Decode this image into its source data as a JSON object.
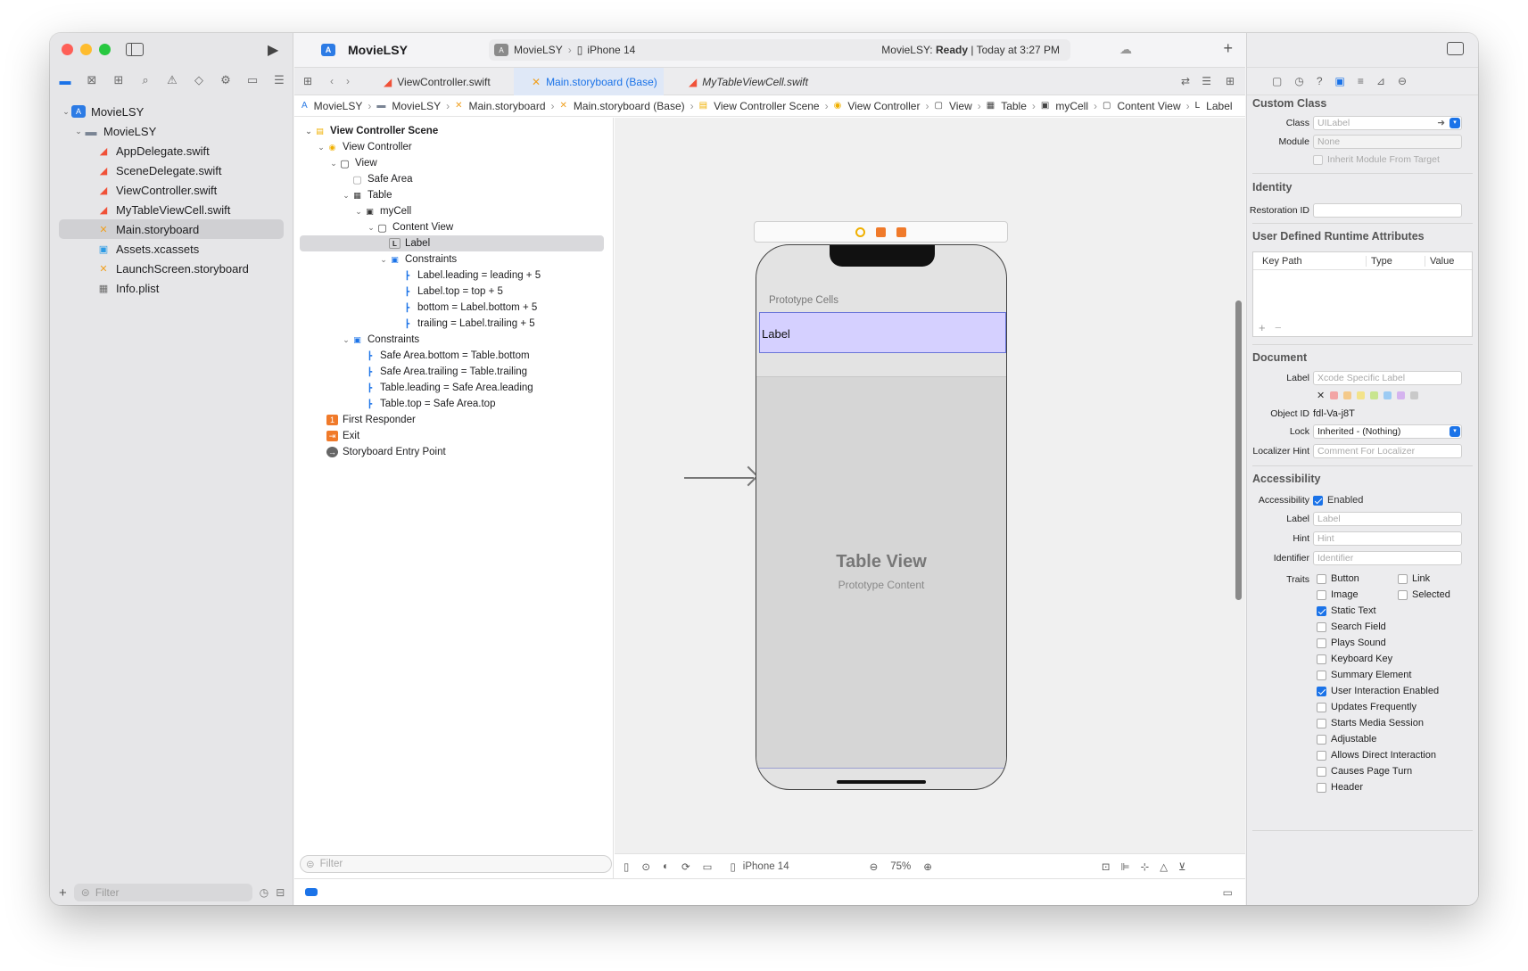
{
  "project": {
    "name": "MovieLSY"
  },
  "scheme": {
    "target": "MovieLSY",
    "device": "iPhone 14",
    "status_prefix": "MovieLSY:",
    "status": "Ready",
    "status_time": "Today at 3:27 PM"
  },
  "navigator": {
    "items": [
      {
        "label": "MovieLSY",
        "kind": "project",
        "level": 0
      },
      {
        "label": "MovieLSY",
        "kind": "folder",
        "level": 1
      },
      {
        "label": "AppDelegate.swift",
        "kind": "swift",
        "level": 2
      },
      {
        "label": "SceneDelegate.swift",
        "kind": "swift",
        "level": 2
      },
      {
        "label": "ViewController.swift",
        "kind": "swift",
        "level": 2
      },
      {
        "label": "MyTableViewCell.swift",
        "kind": "swift",
        "level": 2
      },
      {
        "label": "Main.storyboard",
        "kind": "storyboard",
        "level": 2,
        "selected": true
      },
      {
        "label": "Assets.xcassets",
        "kind": "assets",
        "level": 2
      },
      {
        "label": "LaunchScreen.storyboard",
        "kind": "storyboard",
        "level": 2
      },
      {
        "label": "Info.plist",
        "kind": "plist",
        "level": 2
      }
    ],
    "filter_placeholder": "Filter"
  },
  "tabs": [
    {
      "label": "ViewController.swift"
    },
    {
      "label": "Main.storyboard (Base)",
      "active": true
    },
    {
      "label": "MyTableViewCell.swift"
    }
  ],
  "breadcrumb": [
    "MovieLSY",
    "MovieLSY",
    "Main.storyboard",
    "Main.storyboard (Base)",
    "View Controller Scene",
    "View Controller",
    "View",
    "Table",
    "myCell",
    "Content View",
    "Label"
  ],
  "outline": {
    "items": [
      {
        "label": "View Controller Scene",
        "level": 0,
        "icon": "scene",
        "bold": true
      },
      {
        "label": "View Controller",
        "level": 1,
        "icon": "vc"
      },
      {
        "label": "View",
        "level": 2,
        "icon": "view"
      },
      {
        "label": "Safe Area",
        "level": 3,
        "icon": "safe",
        "leaf": true
      },
      {
        "label": "Table",
        "level": 3,
        "icon": "table"
      },
      {
        "label": "myCell",
        "level": 4,
        "icon": "cell"
      },
      {
        "label": "Content View",
        "level": 5,
        "icon": "view"
      },
      {
        "label": "Label",
        "level": 6,
        "icon": "label",
        "leaf": true,
        "selected": true
      },
      {
        "label": "Constraints",
        "level": 6,
        "icon": "constraints"
      },
      {
        "label": "Label.leading = leading + 5",
        "level": 7,
        "icon": "constraint",
        "leaf": true
      },
      {
        "label": "Label.top = top + 5",
        "level": 7,
        "icon": "constraint",
        "leaf": true
      },
      {
        "label": "bottom = Label.bottom + 5",
        "level": 7,
        "icon": "constraint",
        "leaf": true
      },
      {
        "label": "trailing = Label.trailing + 5",
        "level": 7,
        "icon": "constraint",
        "leaf": true
      },
      {
        "label": "Constraints",
        "level": 3,
        "icon": "constraints"
      },
      {
        "label": "Safe Area.bottom = Table.bottom",
        "level": 4,
        "icon": "constraint",
        "leaf": true
      },
      {
        "label": "Safe Area.trailing = Table.trailing",
        "level": 4,
        "icon": "constraint",
        "leaf": true
      },
      {
        "label": "Table.leading = Safe Area.leading",
        "level": 4,
        "icon": "constraint",
        "leaf": true
      },
      {
        "label": "Table.top = Safe Area.top",
        "level": 4,
        "icon": "constraint",
        "leaf": true
      },
      {
        "label": "First Responder",
        "level": 1,
        "icon": "responder",
        "leaf": true
      },
      {
        "label": "Exit",
        "level": 1,
        "icon": "exit",
        "leaf": true
      },
      {
        "label": "Storyboard Entry Point",
        "level": 1,
        "icon": "entry",
        "leaf": true
      }
    ],
    "filter_placeholder": "Filter"
  },
  "canvas": {
    "prototype_cells": "Prototype Cells",
    "cell_label": "Label",
    "table_title": "Table View",
    "table_subtitle": "Prototype Content",
    "device": "iPhone 14",
    "zoom": "75%"
  },
  "inspector": {
    "custom_class": {
      "title": "Custom Class",
      "class_label": "Class",
      "class_placeholder": "UILabel",
      "module_label": "Module",
      "module_placeholder": "None",
      "inherit_label": "Inherit Module From Target"
    },
    "identity": {
      "title": "Identity",
      "restoration_label": "Restoration ID"
    },
    "runtime": {
      "title": "User Defined Runtime Attributes",
      "col_key": "Key Path",
      "col_type": "Type",
      "col_value": "Value"
    },
    "document": {
      "title": "Document",
      "label_label": "Label",
      "label_placeholder": "Xcode Specific Label",
      "object_id_label": "Object ID",
      "object_id": "fdl-Va-j8T",
      "lock_label": "Lock",
      "lock_value": "Inherited - (Nothing)",
      "localizer_label": "Localizer Hint",
      "localizer_placeholder": "Comment For Localizer",
      "colors": [
        "#f2a5a5",
        "#f4c98a",
        "#f3e38a",
        "#c8e58f",
        "#9ccbf3",
        "#d5b3ef",
        "#c9c9c9"
      ]
    },
    "accessibility": {
      "title": "Accessibility",
      "access_label": "Accessibility",
      "enabled_label": "Enabled",
      "label_label": "Label",
      "label_placeholder": "Label",
      "hint_label": "Hint",
      "hint_placeholder": "Hint",
      "identifier_label": "Identifier",
      "identifier_placeholder": "Identifier",
      "traits_label": "Traits",
      "traits_left": [
        {
          "label": "Button",
          "checked": false
        },
        {
          "label": "Image",
          "checked": false
        },
        {
          "label": "Static Text",
          "checked": true
        },
        {
          "label": "Search Field",
          "checked": false
        },
        {
          "label": "Plays Sound",
          "checked": false
        },
        {
          "label": "Keyboard Key",
          "checked": false
        },
        {
          "label": "Summary Element",
          "checked": false
        },
        {
          "label": "User Interaction Enabled",
          "checked": true
        },
        {
          "label": "Updates Frequently",
          "checked": false
        },
        {
          "label": "Starts Media Session",
          "checked": false
        },
        {
          "label": "Adjustable",
          "checked": false
        },
        {
          "label": "Allows Direct Interaction",
          "checked": false
        },
        {
          "label": "Causes Page Turn",
          "checked": false
        },
        {
          "label": "Header",
          "checked": false
        }
      ],
      "traits_right": [
        {
          "label": "Link",
          "checked": false
        },
        {
          "label": "Selected",
          "checked": false
        }
      ]
    }
  }
}
